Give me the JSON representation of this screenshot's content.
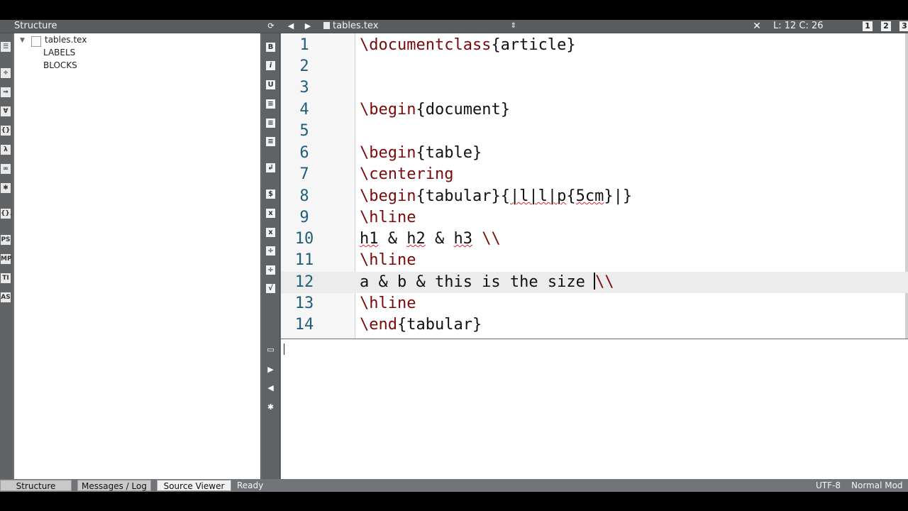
{
  "structure_panel": {
    "title": "Structure",
    "tree": {
      "file": "tables.tex",
      "children": [
        "LABELS",
        "BLOCKS"
      ]
    }
  },
  "editor_tab": {
    "file_name": "tables.tex",
    "cursor_position": "L: 12 C: 26"
  },
  "view_buttons": [
    "1",
    "2",
    "3"
  ],
  "editor": {
    "current_line": 12,
    "lines": [
      {
        "number": "1",
        "text": "\\documentclass{article}"
      },
      {
        "number": "2",
        "text": ""
      },
      {
        "number": "3",
        "text": ""
      },
      {
        "number": "4",
        "text": "\\begin{document}"
      },
      {
        "number": "5",
        "text": ""
      },
      {
        "number": "6",
        "text": "\\begin{table}"
      },
      {
        "number": "7",
        "text": "\\centering"
      },
      {
        "number": "8",
        "text": "\\begin{tabular}{|l|l|p{5cm}|}"
      },
      {
        "number": "9",
        "text": "\\hline"
      },
      {
        "number": "10",
        "text": "h1 & h2 & h3 \\\\"
      },
      {
        "number": "11",
        "text": "\\hline"
      },
      {
        "number": "12",
        "text": "a & b & this is the size \\\\"
      },
      {
        "number": "13",
        "text": "\\hline"
      },
      {
        "number": "14",
        "text": "\\end{tabular}"
      }
    ]
  },
  "bottom_tabs": [
    {
      "label": "Structure",
      "active": false
    },
    {
      "label": "Messages / Log",
      "active": false
    },
    {
      "label": "Source Viewer",
      "active": true
    }
  ],
  "status": {
    "state": "Ready",
    "encoding": "UTF-8",
    "mode": "Normal Mod"
  },
  "colors": {
    "line_number": "#1f5f7a",
    "command": "#7a0a0a",
    "panel_gray": "#6b6f72"
  }
}
